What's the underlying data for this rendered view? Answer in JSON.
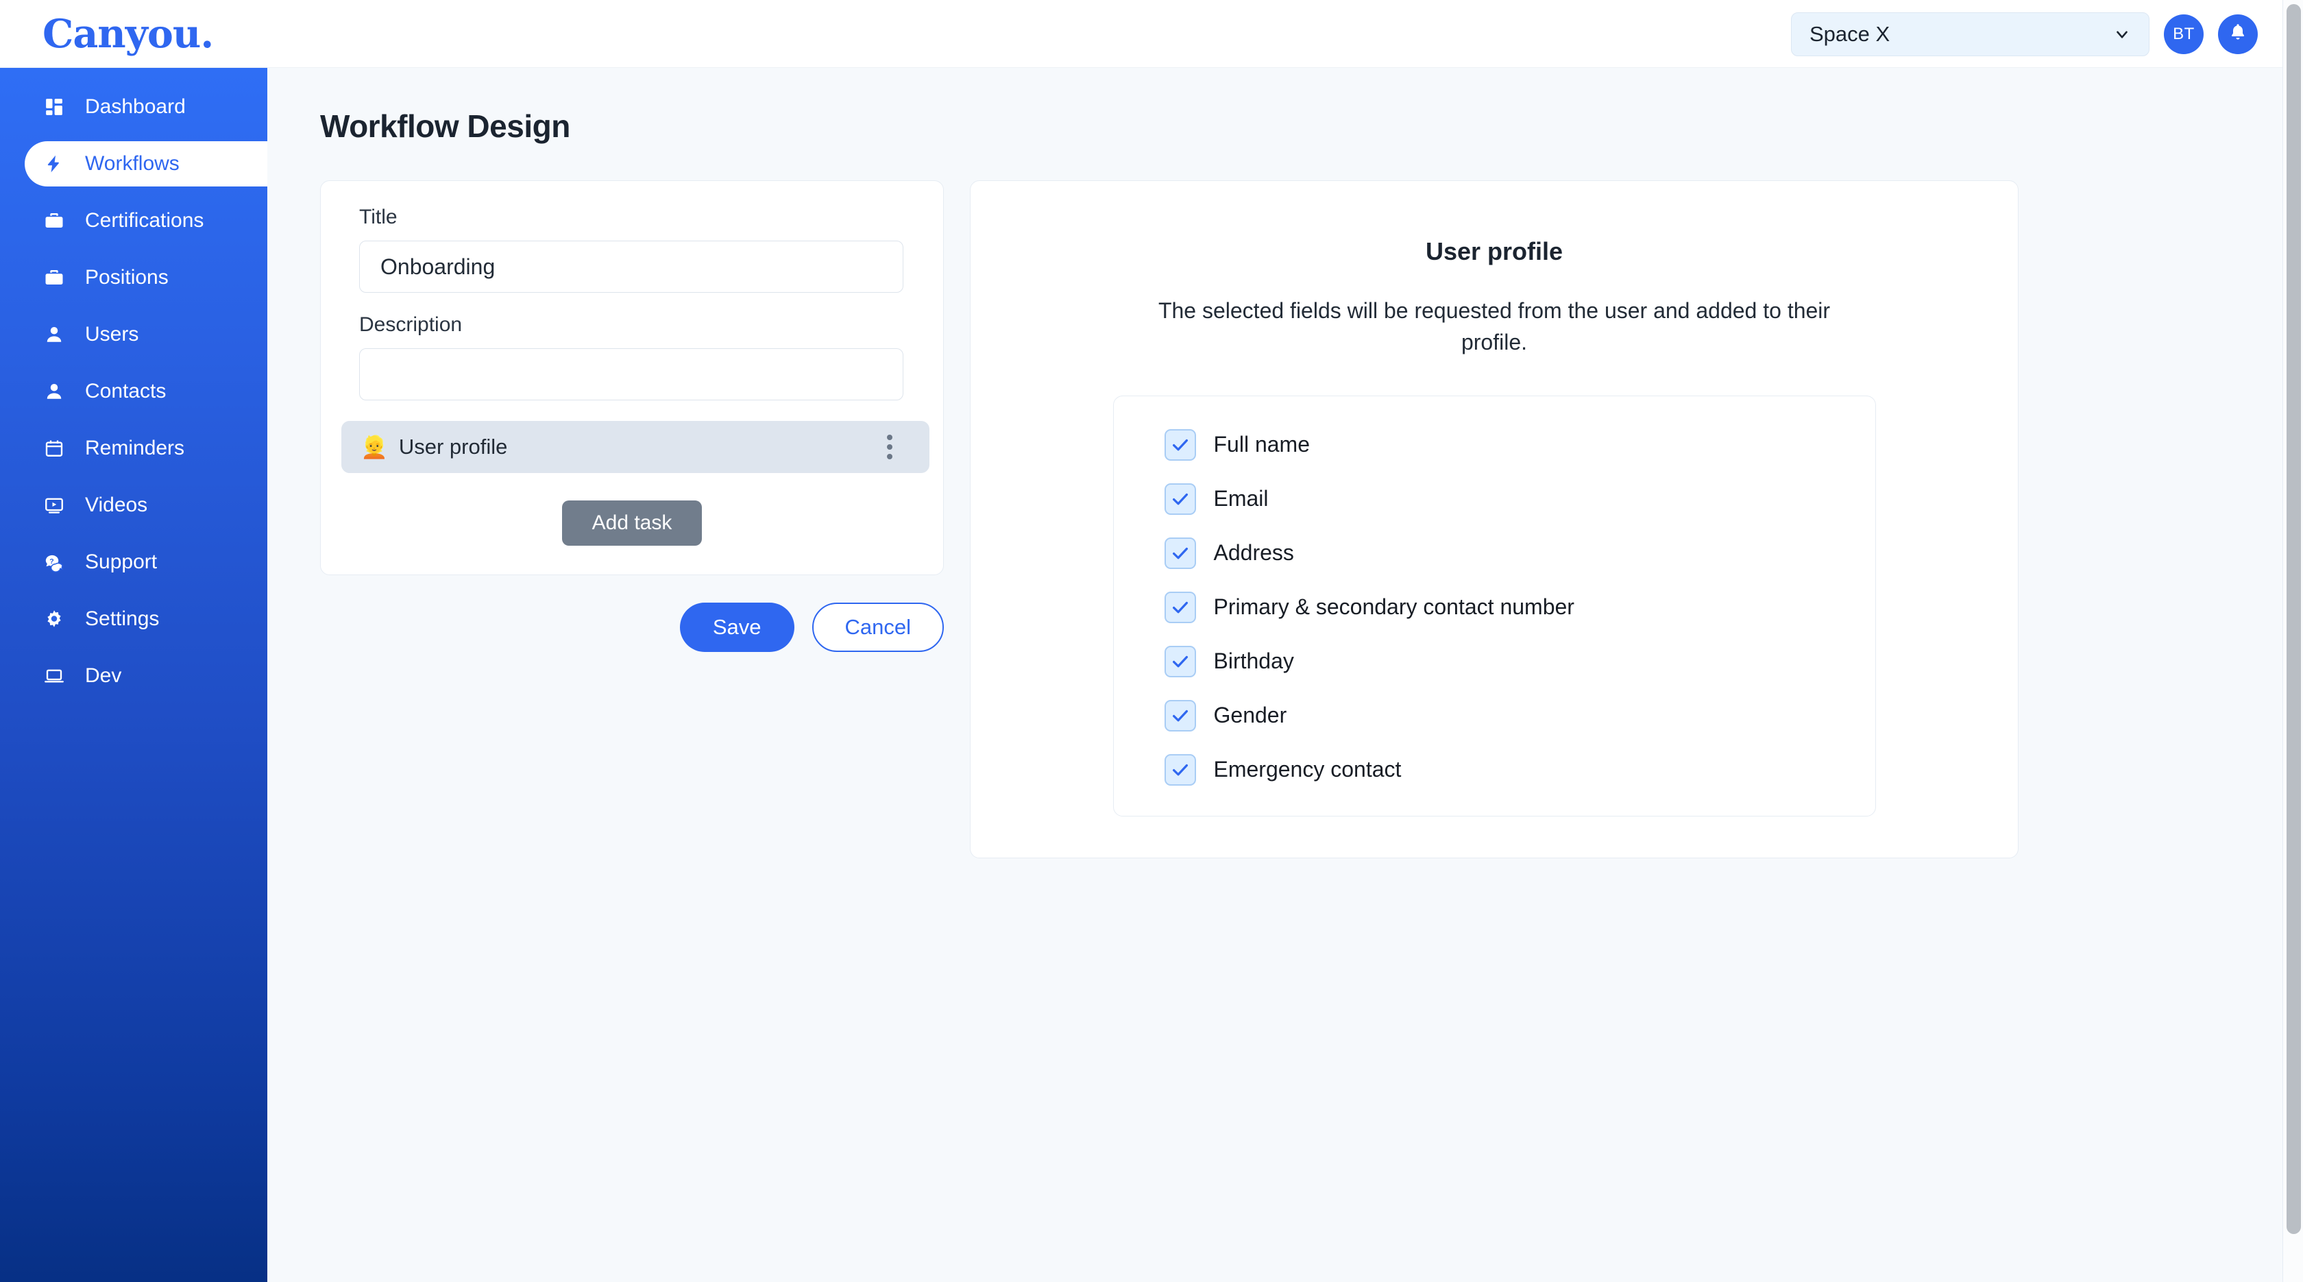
{
  "brand": {
    "logo_text": "Canyou."
  },
  "header": {
    "space_selector": {
      "value": "Space X",
      "icon": "chevron-down-icon"
    },
    "avatar_initials": "BT",
    "notification_icon": "bell-icon"
  },
  "sidebar": {
    "items": [
      {
        "label": "Dashboard",
        "icon": "dashboard-grid-icon",
        "active": false
      },
      {
        "label": "Workflows",
        "icon": "lightning-bolt-icon",
        "active": true
      },
      {
        "label": "Certifications",
        "icon": "briefcase-icon",
        "active": false
      },
      {
        "label": "Positions",
        "icon": "briefcase-icon",
        "active": false
      },
      {
        "label": "Users",
        "icon": "person-icon",
        "active": false
      },
      {
        "label": "Contacts",
        "icon": "person-icon",
        "active": false
      },
      {
        "label": "Reminders",
        "icon": "calendar-icon",
        "active": false
      },
      {
        "label": "Videos",
        "icon": "video-player-icon",
        "active": false
      },
      {
        "label": "Support",
        "icon": "chat-question-icon",
        "active": false
      },
      {
        "label": "Settings",
        "icon": "gear-icon",
        "active": false
      },
      {
        "label": "Dev",
        "icon": "laptop-icon",
        "active": false
      }
    ]
  },
  "main": {
    "page_title": "Workflow Design",
    "design_form": {
      "title_label": "Title",
      "title_value": "Onboarding",
      "title_placeholder": "",
      "description_label": "Description",
      "description_value": "",
      "description_placeholder": "",
      "tasks": [
        {
          "emoji": "👱",
          "label": "User profile",
          "menu_icon": "more-vertical-icon"
        }
      ],
      "add_task_label": "Add task",
      "save_label": "Save",
      "cancel_label": "Cancel"
    },
    "preview": {
      "title": "User profile",
      "description": "The selected fields will be requested from the user and added to their profile.",
      "fields": [
        {
          "label": "Full name",
          "checked": true
        },
        {
          "label": "Email",
          "checked": true
        },
        {
          "label": "Address",
          "checked": true
        },
        {
          "label": "Primary & secondary contact number",
          "checked": true
        },
        {
          "label": "Birthday",
          "checked": true
        },
        {
          "label": "Gender",
          "checked": true
        },
        {
          "label": "Emergency contact",
          "checked": true
        }
      ]
    }
  },
  "colors": {
    "brand_blue": "#2f67f0",
    "sidebar_top": "#2f6ef5",
    "sidebar_bottom": "#073085",
    "page_bg": "#f6f9fc",
    "checkbox_fill": "#ddeeff",
    "checkbox_border": "#a9cdf5",
    "task_row_bg": "#dee5ee",
    "add_task_bg": "#717d8c"
  }
}
